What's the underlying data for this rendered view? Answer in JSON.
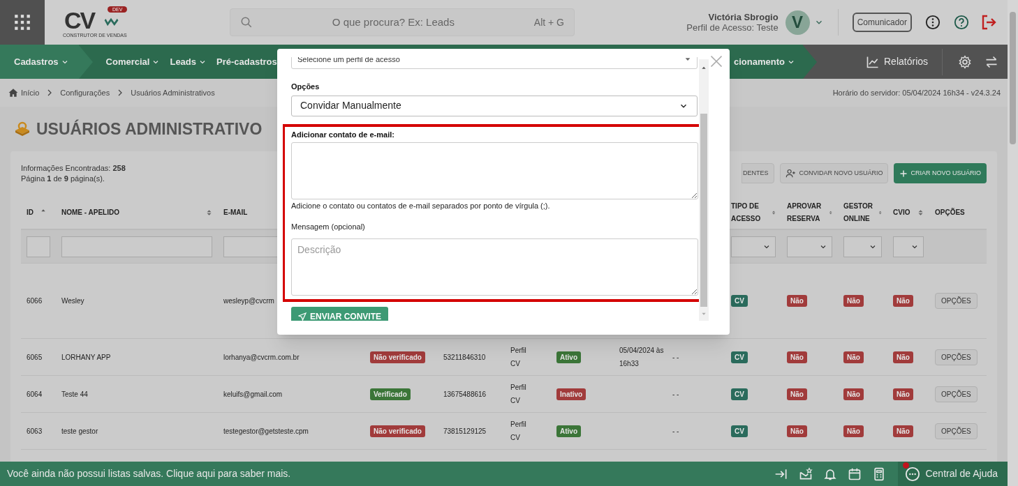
{
  "header": {
    "logo": {
      "letters": "CV",
      "badge": "DEV",
      "tagline": "CONSTRUTOR DE VENDAS"
    },
    "search_placeholder": "O que procura? Ex: Leads",
    "search_shortcut": "Alt + G",
    "user": {
      "name": "Victória Sbrogio",
      "profile": "Perfil de Acesso: Teste",
      "initial": "V"
    },
    "communicator": "Comunicador"
  },
  "nav": {
    "items": [
      {
        "label": "Cadastros",
        "selected": true
      },
      {
        "label": "Comercial",
        "selected": false
      },
      {
        "label": "Leads",
        "selected": false
      },
      {
        "label": "Pré-cadastros",
        "selected": false
      },
      {
        "label": "cionamento",
        "selected": false
      }
    ],
    "reports": "Relatórios"
  },
  "breadcrumb": [
    "Início",
    "Configurações",
    "Usuários Administrativos"
  ],
  "server_time": "Horário do servidor: 05/04/2024 16h34 - v24.3.24",
  "page_title": "USUÁRIOS ADMINISTRATIVO",
  "summary": [
    "Informações Encontradas: **258**",
    "Página **1** de **9** página(s)."
  ],
  "toolbar": [
    {
      "label": "DENTES",
      "kind": "plain"
    },
    {
      "label": "CONVIDAR NOVO USUÁRIO",
      "kind": "invite"
    },
    {
      "label": "CRIAR NOVO USUÁRIO",
      "kind": "create"
    }
  ],
  "table": {
    "columns": [
      {
        "label": "ID",
        "kind": "sorted"
      },
      {
        "label": "NOME - APELIDO",
        "kind": "sortable"
      },
      {
        "label": "E-MAIL",
        "kind": "plain"
      },
      {},
      {},
      {},
      {},
      {},
      {},
      {
        "label": "TIPO DE ACESSO",
        "kind": "sortable"
      },
      {
        "label": "APROVAR RESERVA",
        "kind": "sortable"
      },
      {
        "label": "GESTOR ONLINE",
        "kind": "sortable"
      },
      {
        "label": "CVIO",
        "kind": "sortable"
      },
      {
        "label": "OPÇÕES",
        "kind": "plain"
      }
    ],
    "filters": [
      {
        "kind": "text"
      },
      {
        "kind": "text"
      },
      {
        "kind": "text"
      },
      {
        "kind": "blank"
      },
      {
        "kind": "blank"
      },
      {
        "kind": "blank"
      },
      {
        "kind": "blank"
      },
      {
        "kind": "blank"
      },
      {
        "kind": "blank"
      },
      {
        "kind": "select"
      },
      {
        "kind": "select"
      },
      {
        "kind": "select"
      },
      {
        "kind": "select"
      },
      {
        "kind": "blank"
      }
    ],
    "rows": [
      {
        "tall": true,
        "cells": [
          {
            "text": "6066"
          },
          {
            "text": "Wesley"
          },
          {
            "text": "wesleyp@cvcrm"
          },
          {},
          {},
          {},
          {},
          {},
          {},
          {
            "text": "CV",
            "color": "#2a6b5c"
          },
          {
            "text": "Não",
            "color": "#a13b3b"
          },
          {
            "text": "Não",
            "color": "#a13b3b"
          },
          {
            "text": "Não",
            "color": "#a13b3b"
          },
          {
            "text": "OPÇÕES",
            "kind": "button"
          }
        ]
      },
      {
        "tall": false,
        "cells": [
          {
            "text": "6065"
          },
          {
            "text": "LORHANY APP"
          },
          {
            "text": "lorhanya@cvcrm.com.br"
          },
          {
            "text": "Não verificado",
            "color": "#a13b3b"
          },
          {
            "text": "53211846310"
          },
          {
            "text": "Perfil CV"
          },
          {
            "text": "Ativo",
            "color": "#3b7538"
          },
          {
            "text": "05/04/2024 às 16h33"
          },
          {
            "text": "- -"
          },
          {
            "text": "CV",
            "color": "#2a6b5c"
          },
          {
            "text": "Não",
            "color": "#a13b3b"
          },
          {
            "text": "Não",
            "color": "#a13b3b"
          },
          {
            "text": "Não",
            "color": "#a13b3b"
          },
          {
            "text": "OPÇÕES",
            "kind": "button"
          }
        ]
      },
      {
        "tall": false,
        "cells": [
          {
            "text": "6064"
          },
          {
            "text": "Teste 44"
          },
          {
            "text": "keluifs@gmail.com"
          },
          {
            "text": "Verificado",
            "color": "#3b7538"
          },
          {
            "text": "13675488616"
          },
          {
            "text": "Perfil CV"
          },
          {
            "text": "Inativo",
            "color": "#a13b3b"
          },
          {},
          {
            "text": "- -"
          },
          {
            "text": "CV",
            "color": "#2a6b5c"
          },
          {
            "text": "Não",
            "color": "#a13b3b"
          },
          {
            "text": "Não",
            "color": "#a13b3b"
          },
          {
            "text": "Não",
            "color": "#a13b3b"
          },
          {
            "text": "OPÇÕES",
            "kind": "button"
          }
        ]
      },
      {
        "tall": false,
        "cells": [
          {
            "text": "6063"
          },
          {
            "text": "teste gestor"
          },
          {
            "text": "testegestor@getsteste.cpm"
          },
          {
            "text": "Não verificado",
            "color": "#a13b3b"
          },
          {
            "text": "73815129125"
          },
          {
            "text": "Perfil CV"
          },
          {
            "text": "Ativo",
            "color": "#3b7538"
          },
          {},
          {
            "text": "- -"
          },
          {
            "text": "CV",
            "color": "#2a6b5c"
          },
          {
            "text": "Não",
            "color": "#a13b3b"
          },
          {
            "text": "Não",
            "color": "#a13b3b"
          },
          {
            "text": "Não",
            "color": "#a13b3b"
          },
          {
            "text": "OPÇÕES",
            "kind": "button"
          }
        ]
      }
    ]
  },
  "modal": {
    "profile_select": "Selecione um perfil de acesso",
    "options_label": "Opções",
    "options_value": "Convidar Manualmente",
    "email_label": "Adicionar contato de e-mail:",
    "email_hint": "Adicione o contato ou contatos de e-mail separados por ponto de vírgula (;).",
    "message_label": "Mensagem (opcional)",
    "message_placeholder": "Descrição",
    "submit": "ENVIAR CONVITE",
    "highlighted": true
  },
  "footer": {
    "message": "Você ainda não possui listas salvas. Clique aqui para saber mais.",
    "help": "Central de Ajuda",
    "help_notification": true
  }
}
